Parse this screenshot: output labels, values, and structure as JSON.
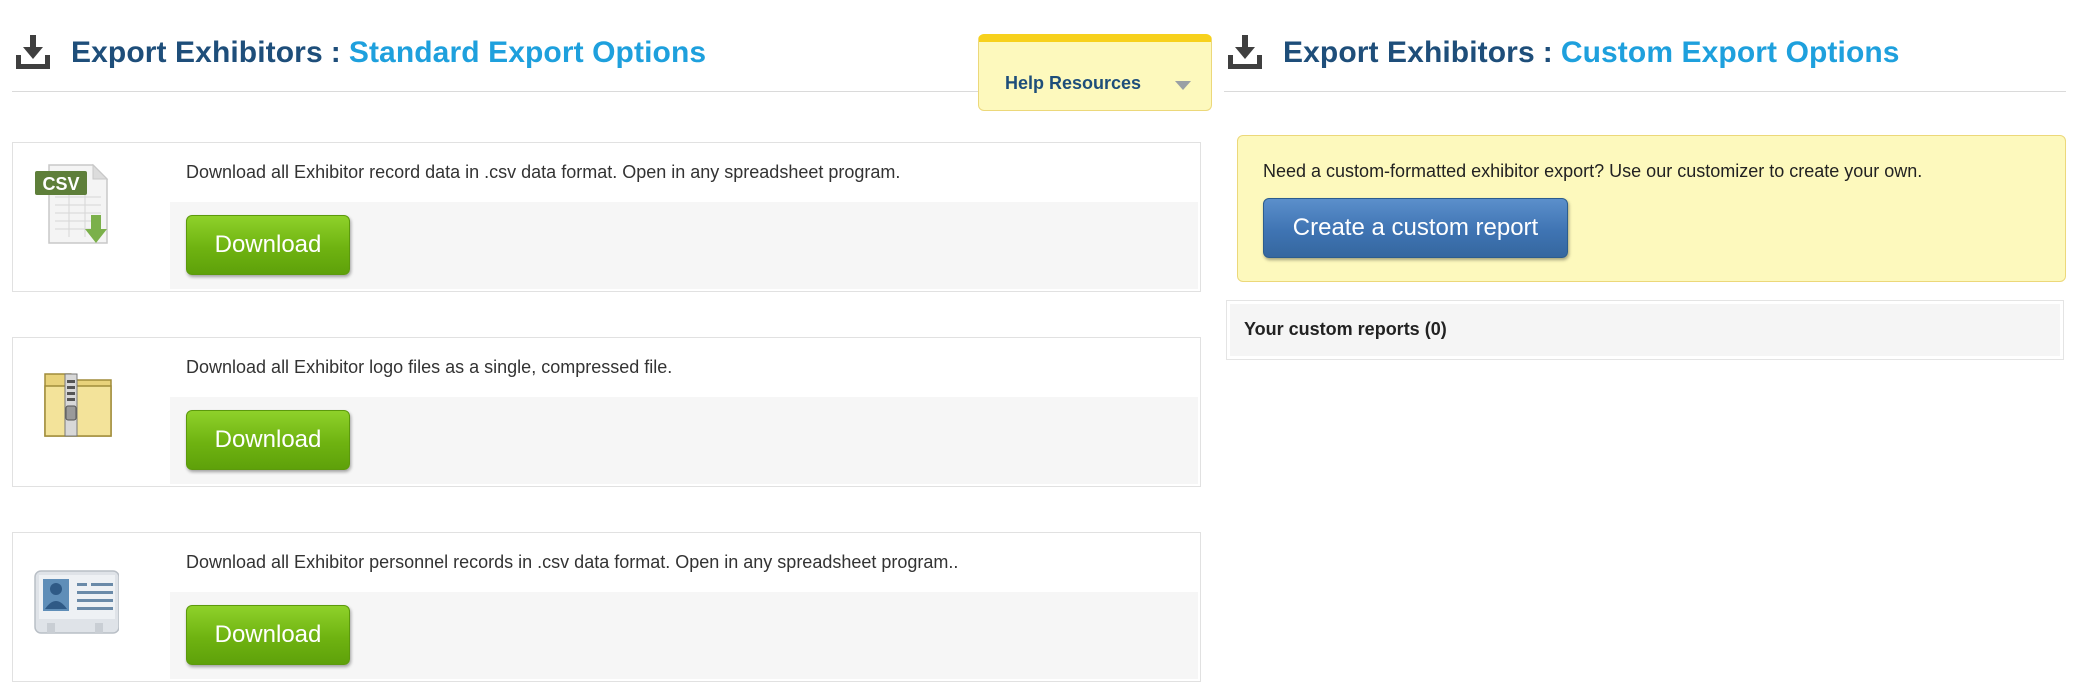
{
  "standard": {
    "title": "Export Exhibitors",
    "separator": ":",
    "subtitle": "Standard Export Options",
    "icon": "download-tray-icon"
  },
  "help": {
    "label": "Help Resources",
    "icon": "caret-down-icon"
  },
  "exports": [
    {
      "icon": "csv-file-icon",
      "icon_text": "CSV",
      "description": "Download all Exhibitor record data in .csv data format. Open in any spreadsheet program.",
      "button_label": "Download"
    },
    {
      "icon": "zip-folder-icon",
      "description": "Download all Exhibitor logo files as a single, compressed file.",
      "button_label": "Download"
    },
    {
      "icon": "id-card-icon",
      "description": "Download all Exhibitor personnel records in .csv data format. Open in any spreadsheet program..",
      "button_label": "Download"
    }
  ],
  "custom": {
    "title": "Export Exhibitors",
    "separator": ":",
    "subtitle": "Custom Export Options",
    "icon": "download-tray-icon",
    "description": "Need a custom-formatted exhibitor export? Use our customizer to create your own.",
    "button_label": "Create a custom report",
    "reports_label": "Your custom reports (0)"
  },
  "colors": {
    "title": "#1e4e7a",
    "accent": "#1ea0dd",
    "download_green": "#6fb311",
    "custom_blue": "#3f74b3",
    "help_yellow": "#fdf9bd",
    "help_border_top": "#f7d11c"
  }
}
